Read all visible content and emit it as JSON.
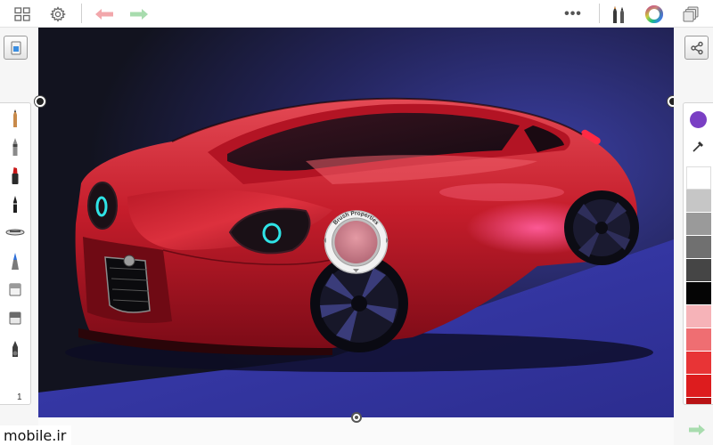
{
  "app": {
    "accent": "#7a3fc4"
  },
  "toolbar": {
    "items": [
      {
        "name": "gallery-icon"
      },
      {
        "name": "gear-icon"
      },
      {
        "name": "undo-icon"
      },
      {
        "name": "redo-icon"
      },
      {
        "name": "more-icon",
        "label": "•••"
      },
      {
        "name": "brush-library-icon"
      },
      {
        "name": "color-wheel-icon"
      },
      {
        "name": "layers-icon"
      }
    ],
    "more_label": "•••"
  },
  "left_tools": {
    "items": [
      "pencil-icon",
      "ballpoint-pen-icon",
      "marker-icon",
      "felt-tip-icon",
      "airbrush-icon",
      "paint-brush-icon",
      "eraser-icon",
      "hard-eraser-icon",
      "smudge-icon"
    ],
    "brush_number": "1"
  },
  "right_colors": {
    "current_color": "#7a3fc4",
    "swatches": [
      "#ffffff",
      "#c6c6c6",
      "#9a9a9a",
      "#707070",
      "#454545",
      "#050505",
      "#f6b3b8",
      "#ef6e72",
      "#e83436",
      "#dd1c1e",
      "#b81214"
    ]
  },
  "brush_puck": {
    "label": "Brush Properties",
    "color": "#c97b86"
  },
  "watermark": "mobile.ir"
}
